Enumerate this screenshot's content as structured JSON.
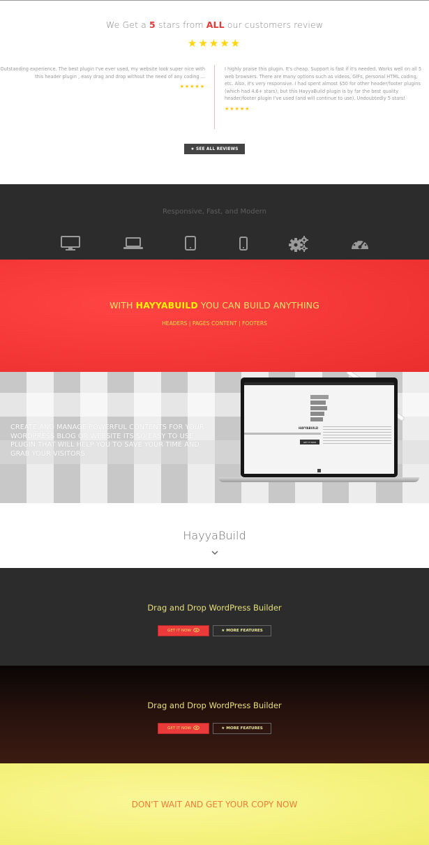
{
  "reviews": {
    "title_pre": "We Get a ",
    "title_num": "5",
    "title_mid": " stars from ",
    "title_all": "ALL",
    "title_post": " our customers review",
    "stars": "★★★★★",
    "left_review": "Outstanding experience. The best plugin I've ever used, my website look super nice with this header plugin , easy drag and drop without the need of any coding ...",
    "right_review": "I highly praise this plugin. It's cheap. Support is fast if it's needed. Works well on all 5 web browsers. There are many options such as videos, GIFs, personal HTML coding, etc. Also, it's very responsive. I had spent almost $50 for other header/footer plugins (which had 4.6+ stars), but this HayyaBuild plugin is by far the best quality header/footer plugin I've used (and will continue to use). Undoubtedly 5 stars!",
    "mini_stars": "★★★★★",
    "see_all_label": "★ SEE ALL REVIEWS"
  },
  "responsive": {
    "title": "Responsive, Fast, and Modern",
    "icons": [
      "desktop-icon",
      "laptop-icon",
      "tablet-icon",
      "mobile-icon",
      "gears-icon",
      "dashboard-icon"
    ]
  },
  "red_banner": {
    "title_pre": "WITH ",
    "title_brand": "HAYYABUILD",
    "title_post": " YOU CAN BUILD ANYTHING",
    "subtitle": "HEADERS | PAGES CONTENT | FOOTERS"
  },
  "laptop_section": {
    "text": "CREATE AND MANAGE POWERFUL CONTENTS FOR YOUR WORDPRESS BLOG OR WEBSITE ITS SO EASY TO USE PLUGIN THAT WILL HELP YOU TO SAVE YOUR TIME AND GRAB YOUR VISITORS",
    "screen_brand": "HAYYABUILD",
    "screen_button": "GET IT NOW"
  },
  "hayyabuild": {
    "title": "HayyaBuild"
  },
  "cta1": {
    "title": "Drag and Drop WordPress Builder",
    "get_label": "GET IT NOW",
    "features_label": "MORE FEATURES"
  },
  "cta2": {
    "title": "Drag and Drop WordPress Builder",
    "get_label": "GET IT NOW",
    "features_label": "MORE FEATURES"
  },
  "yellow": {
    "title": "DON'T WAIT AND GET YOUR COPY NOW"
  },
  "colors": {
    "accent_red": "#f53838",
    "accent_yellow": "#fff200",
    "dark_bg": "#2c2c2c",
    "cta_yellow_bg": "#f5f27d",
    "cta_orange_text": "#f07c38"
  }
}
